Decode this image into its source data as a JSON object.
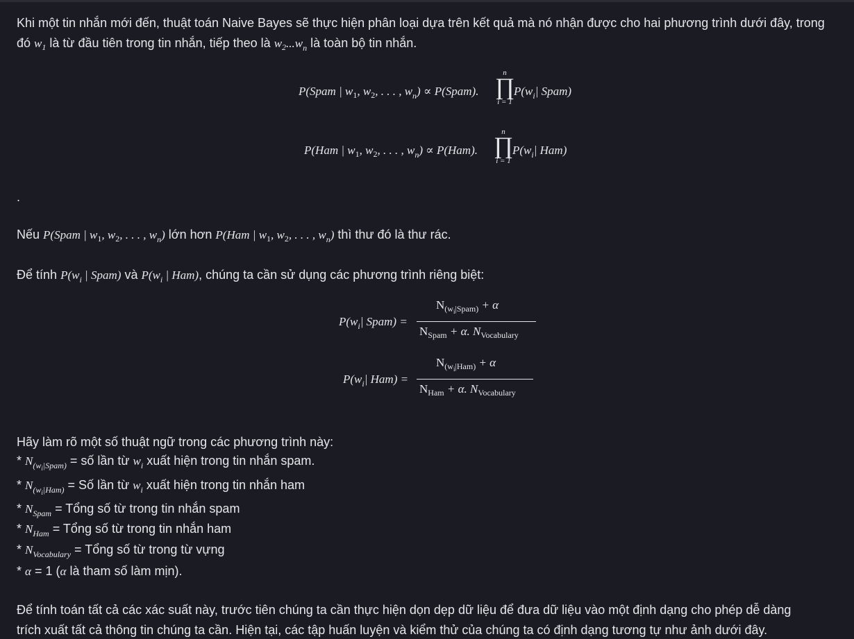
{
  "intro": {
    "line1": "Khi một tin nhắn mới đến, thuật toán Naive Bayes sẽ thực hiện phân loại dựa trên kết quả mà nó nhận được cho hai phương trình dưới đây, trong",
    "line2_a": "đó",
    "line2_b": "là từ đầu tiên trong tin nhắn, tiếp theo là",
    "line2_c": "là toàn bộ tin nhắn."
  },
  "equations": {
    "spam_lhs": "P(Spam | w",
    "spam_rhs": "∝ P(Spam).",
    "spam_term": "P(w",
    "spam_term_end": "| Spam)",
    "ham_lhs": "P(Ham | w",
    "ham_rhs": "∝ P(Ham).",
    "ham_term": "P(w",
    "ham_term_end": "| Ham)",
    "prod_upper": "n",
    "prod_lower": "i = 1",
    "args": ", w",
    "dots": ", . . . , w",
    "close": ")"
  },
  "dot_line": ".",
  "comparison": {
    "prefix": "Nếu",
    "middle": "lớn hơn",
    "suffix": "thì thư đó là thư rác."
  },
  "compute_intro": {
    "prefix": "Để tính",
    "and": "và",
    "suffix": ", chúng ta cần sử dụng các phương trình riêng biệt:"
  },
  "fractions": {
    "spam_lhs": "P(w",
    "spam_lhs_end": "| Spam) =",
    "spam_num_sub": "(w",
    "spam_num_sub_end": "|Spam)",
    "spam_den_a": "Spam",
    "ham_lhs": "P(w",
    "ham_lhs_end": "| Ham) =",
    "ham_num_sub_end": "|Ham)",
    "ham_den_a": "Ham",
    "N": "N",
    "plus_alpha": "+ α",
    "plus_alpha_dot": "+ α. N",
    "vocab": "Vocabulary",
    "i": "i"
  },
  "terms": {
    "heading": "Hãy làm rõ một số thuật ngữ trong các phương trình này:",
    "bullet": "*",
    "item1": "= số lần từ",
    "item1_end": "xuất hiện trong tin nhắn spam.",
    "item2": "= Số lần từ",
    "item2_end": "xuất hiện trong tin nhắn ham",
    "item3": "= Tổng số từ trong tin nhắn spam",
    "item4": "= Tổng số từ trong tin nhắn ham",
    "item5": "= Tổng số từ trong từ vựng",
    "item6_a": "α",
    "item6_b": "= 1 (",
    "item6_c": "là tham số làm mịn)."
  },
  "closing": {
    "line1": "Để tính toán tất cả các xác suất này, trước tiên chúng ta cần thực hiện dọn dẹp dữ liệu để đưa dữ liệu vào một định dạng cho phép dễ dàng",
    "line2": "trích xuất tất cả thông tin chúng ta cần. Hiện tại, các tập huấn luyện và kiểm thử của chúng ta có định dạng tương tự như ảnh dưới đây."
  }
}
